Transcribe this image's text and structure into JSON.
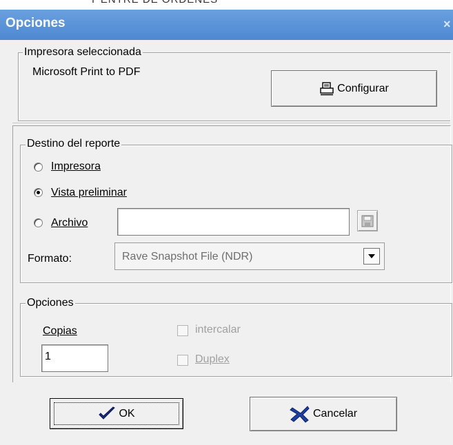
{
  "window": {
    "title": "Opciones",
    "close_glyph": "×",
    "background_fragment": "Y ENTRE DE ORDENES"
  },
  "printer": {
    "group_label": "Impresora seleccionada",
    "name": "Microsoft Print to PDF",
    "configure_label": "Configurar",
    "configure_icon": "printer-icon"
  },
  "destination": {
    "group_label": "Destino del reporte",
    "options": [
      {
        "label": "Impresora",
        "selected": false
      },
      {
        "label": "Vista preliminar",
        "selected": true
      },
      {
        "label": "Archivo",
        "selected": false
      }
    ],
    "file_path": "",
    "save_icon": "floppy-disk-icon",
    "format_label": "Formato:",
    "format_value": "Rave Snapshot File (NDR)"
  },
  "options": {
    "group_label": "Opciones",
    "copies_label": "Copias",
    "copies_value": "1",
    "collate_label": "intercalar",
    "collate_checked": false,
    "duplex_label": "Duplex",
    "duplex_checked": false
  },
  "actions": {
    "ok_label": "OK",
    "ok_icon": "checkmark-icon",
    "cancel_label": "Cancelar",
    "cancel_icon": "cross-icon"
  },
  "colors": {
    "titlebar": "#5a94d8",
    "face": "#f0f0f0"
  }
}
